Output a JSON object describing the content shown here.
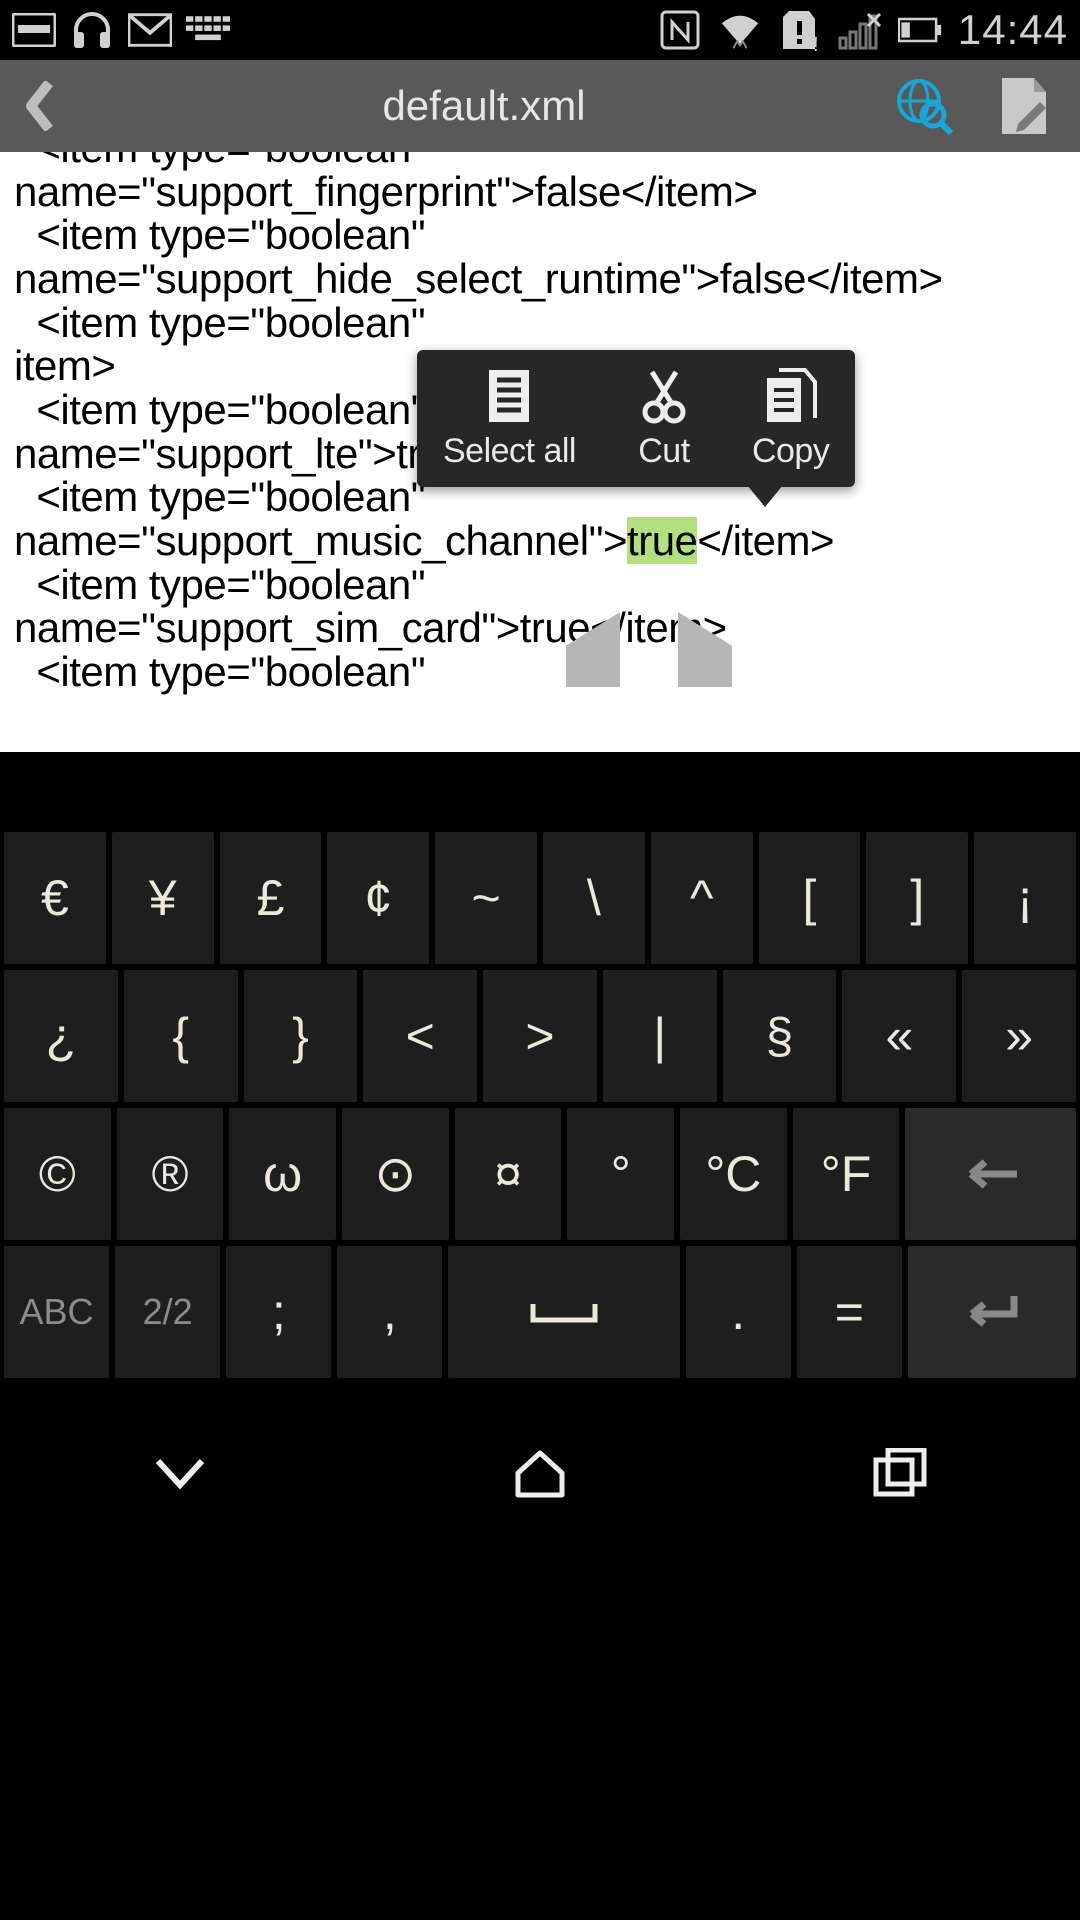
{
  "status": {
    "time": "14:44"
  },
  "appbar": {
    "title": "default.xml"
  },
  "editor": {
    "l0": "  <item type=\"boolean\"",
    "l1": "name=\"support_fingerprint\">false</item>",
    "l2": "  <item type=\"boolean\"",
    "l3": "name=\"support_hide_select_runtime\">false</item>",
    "l4a": "  <item type=\"boolean\" ",
    "l4b": "item>",
    "l5": "  <item type=\"boolean\"",
    "l6": "name=\"support_lte\">true</item>",
    "l7": "  <item type=\"boolean\"",
    "l8a": "name=\"support_music_channel\">",
    "l8sel": "true",
    "l8b": "</item>",
    "l9": "  <item type=\"boolean\"",
    "l10": "name=\"support_sim_card\">true</item>",
    "l11": "  <item type=\"boolean\""
  },
  "ctx": {
    "select_all": "Select all",
    "cut": "Cut",
    "copy": "Copy"
  },
  "kbd": {
    "r1": [
      "€",
      "¥",
      "£",
      "¢",
      "~",
      "\\",
      "^",
      "[",
      "]",
      "¡"
    ],
    "r2": [
      "¿",
      "{",
      "}",
      "<",
      ">",
      "|",
      "§",
      "«",
      "»"
    ],
    "r3": [
      "©",
      "®",
      "ω",
      "⊙",
      "¤",
      "°",
      "°C",
      "°F"
    ],
    "r4": {
      "abc": "ABC",
      "page": "2/2",
      "semi": ";",
      "comma": ",",
      "space": "⎵",
      "dot": ".",
      "eq": "="
    }
  }
}
